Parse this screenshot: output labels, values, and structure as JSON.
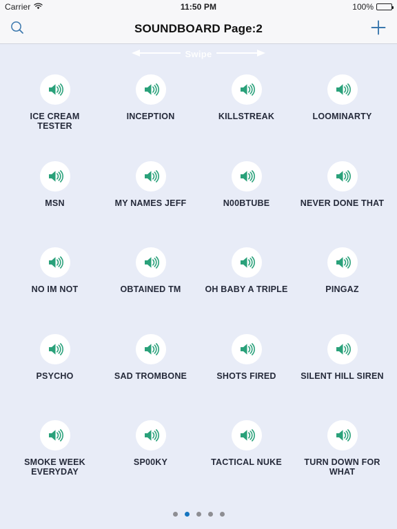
{
  "status_bar": {
    "carrier": "Carrier",
    "wifi_icon": "wifi-icon",
    "time": "11:50 PM",
    "battery_percent": "100%",
    "battery_level": 100,
    "battery_icon": "battery-full-icon"
  },
  "nav_bar": {
    "search_icon": "search-icon",
    "title": "SOUNDBOARD Page:2",
    "add_icon": "plus-icon"
  },
  "swipe_hint": {
    "label": "Swipe",
    "left_arrow_icon": "arrow-left-icon",
    "right_arrow_icon": "arrow-right-icon"
  },
  "grid": {
    "speaker_icon": "speaker-wave-icon",
    "accent_color": "#2aa17a",
    "label_color": "#252a3a",
    "background_color": "#e8ecf7",
    "buttons": [
      {
        "label": "ICE CREAM TESTER"
      },
      {
        "label": "INCEPTION"
      },
      {
        "label": "KILLSTREAK"
      },
      {
        "label": "LOOMINARTY"
      },
      {
        "label": "MSN"
      },
      {
        "label": "MY NAMES JEFF"
      },
      {
        "label": "N00BTUBE"
      },
      {
        "label": "NEVER DONE THAT"
      },
      {
        "label": "NO IM NOT"
      },
      {
        "label": "OBTAINED TM"
      },
      {
        "label": "OH BABY A TRIPLE"
      },
      {
        "label": "PINGAZ"
      },
      {
        "label": "PSYCHO"
      },
      {
        "label": "SAD TROMBONE"
      },
      {
        "label": "SHOTS FIRED"
      },
      {
        "label": "SILENT HILL SIREN"
      },
      {
        "label": "SMOKE WEEK EVERYDAY"
      },
      {
        "label": "SP00KY"
      },
      {
        "label": "TACTICAL NUKE"
      },
      {
        "label": "TURN DOWN FOR WHAT"
      }
    ]
  },
  "page_dots": {
    "count": 5,
    "active_index": 1,
    "active_color": "#1675c0",
    "inactive_color": "#8e8e93"
  }
}
